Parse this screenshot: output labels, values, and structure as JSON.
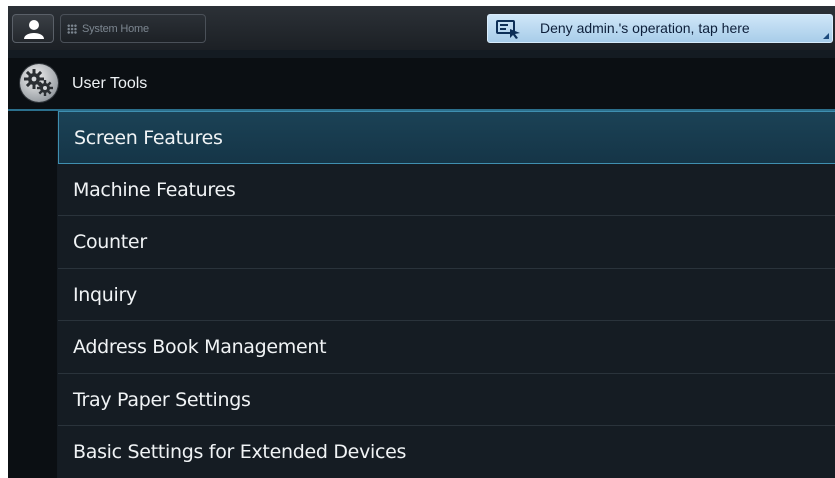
{
  "topbar": {
    "user_icon": "user-icon",
    "home_label": "System Home",
    "home_icon": "grid-icon",
    "deny_label": "Deny admin.'s operation, tap here",
    "deny_icon": "remote-operation-icon"
  },
  "header": {
    "title": "User Tools",
    "icon": "gears-icon"
  },
  "menu": {
    "items": [
      {
        "label": "Screen Features",
        "selected": true
      },
      {
        "label": "Machine Features",
        "selected": false
      },
      {
        "label": "Counter",
        "selected": false
      },
      {
        "label": "Inquiry",
        "selected": false
      },
      {
        "label": "Address Book Management",
        "selected": false
      },
      {
        "label": "Tray Paper Settings",
        "selected": false
      },
      {
        "label": "Basic Settings for Extended Devices",
        "selected": false
      }
    ]
  },
  "colors": {
    "background": "#141b22",
    "selected_row": "#1b4256",
    "selected_border": "#3f8fb0",
    "deny_button": "#bcdcf2"
  }
}
